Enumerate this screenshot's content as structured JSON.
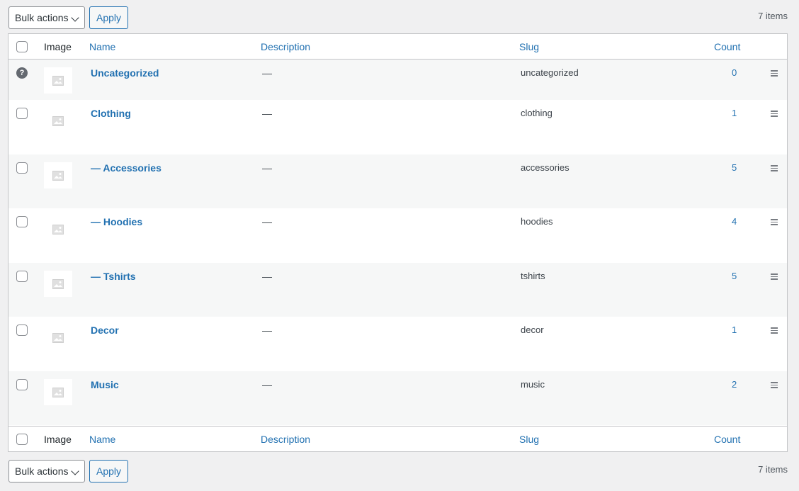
{
  "toolbar_top": {
    "bulk_label": "Bulk actions",
    "apply_label": "Apply",
    "items_count": "7 items"
  },
  "toolbar_bottom": {
    "bulk_label": "Bulk actions",
    "apply_label": "Apply",
    "items_count": "7 items"
  },
  "columns": {
    "image": "Image",
    "name": "Name",
    "description": "Description",
    "slug": "Slug",
    "count": "Count"
  },
  "rows": [
    {
      "name": "Uncategorized",
      "description": "—",
      "slug": "uncategorized",
      "count": "0",
      "selectable": false
    },
    {
      "name": "Clothing",
      "description": "—",
      "slug": "clothing",
      "count": "1",
      "selectable": true
    },
    {
      "name": "— Accessories",
      "description": "—",
      "slug": "accessories",
      "count": "5",
      "selectable": true
    },
    {
      "name": "— Hoodies",
      "description": "—",
      "slug": "hoodies",
      "count": "4",
      "selectable": true
    },
    {
      "name": "— Tshirts",
      "description": "—",
      "slug": "tshirts",
      "count": "5",
      "selectable": true
    },
    {
      "name": "Decor",
      "description": "—",
      "slug": "decor",
      "count": "1",
      "selectable": true
    },
    {
      "name": "Music",
      "description": "—",
      "slug": "music",
      "count": "2",
      "selectable": true
    }
  ],
  "help_icon_glyph": "?",
  "icons": {
    "dropdown": "chevron-down-icon",
    "placeholder": "image-placeholder-icon",
    "drag": "drag-handle-icon",
    "help": "help-icon"
  },
  "colors": {
    "link": "#2271b1",
    "background": "#f0f0f1",
    "row_alt": "#f6f7f7"
  }
}
